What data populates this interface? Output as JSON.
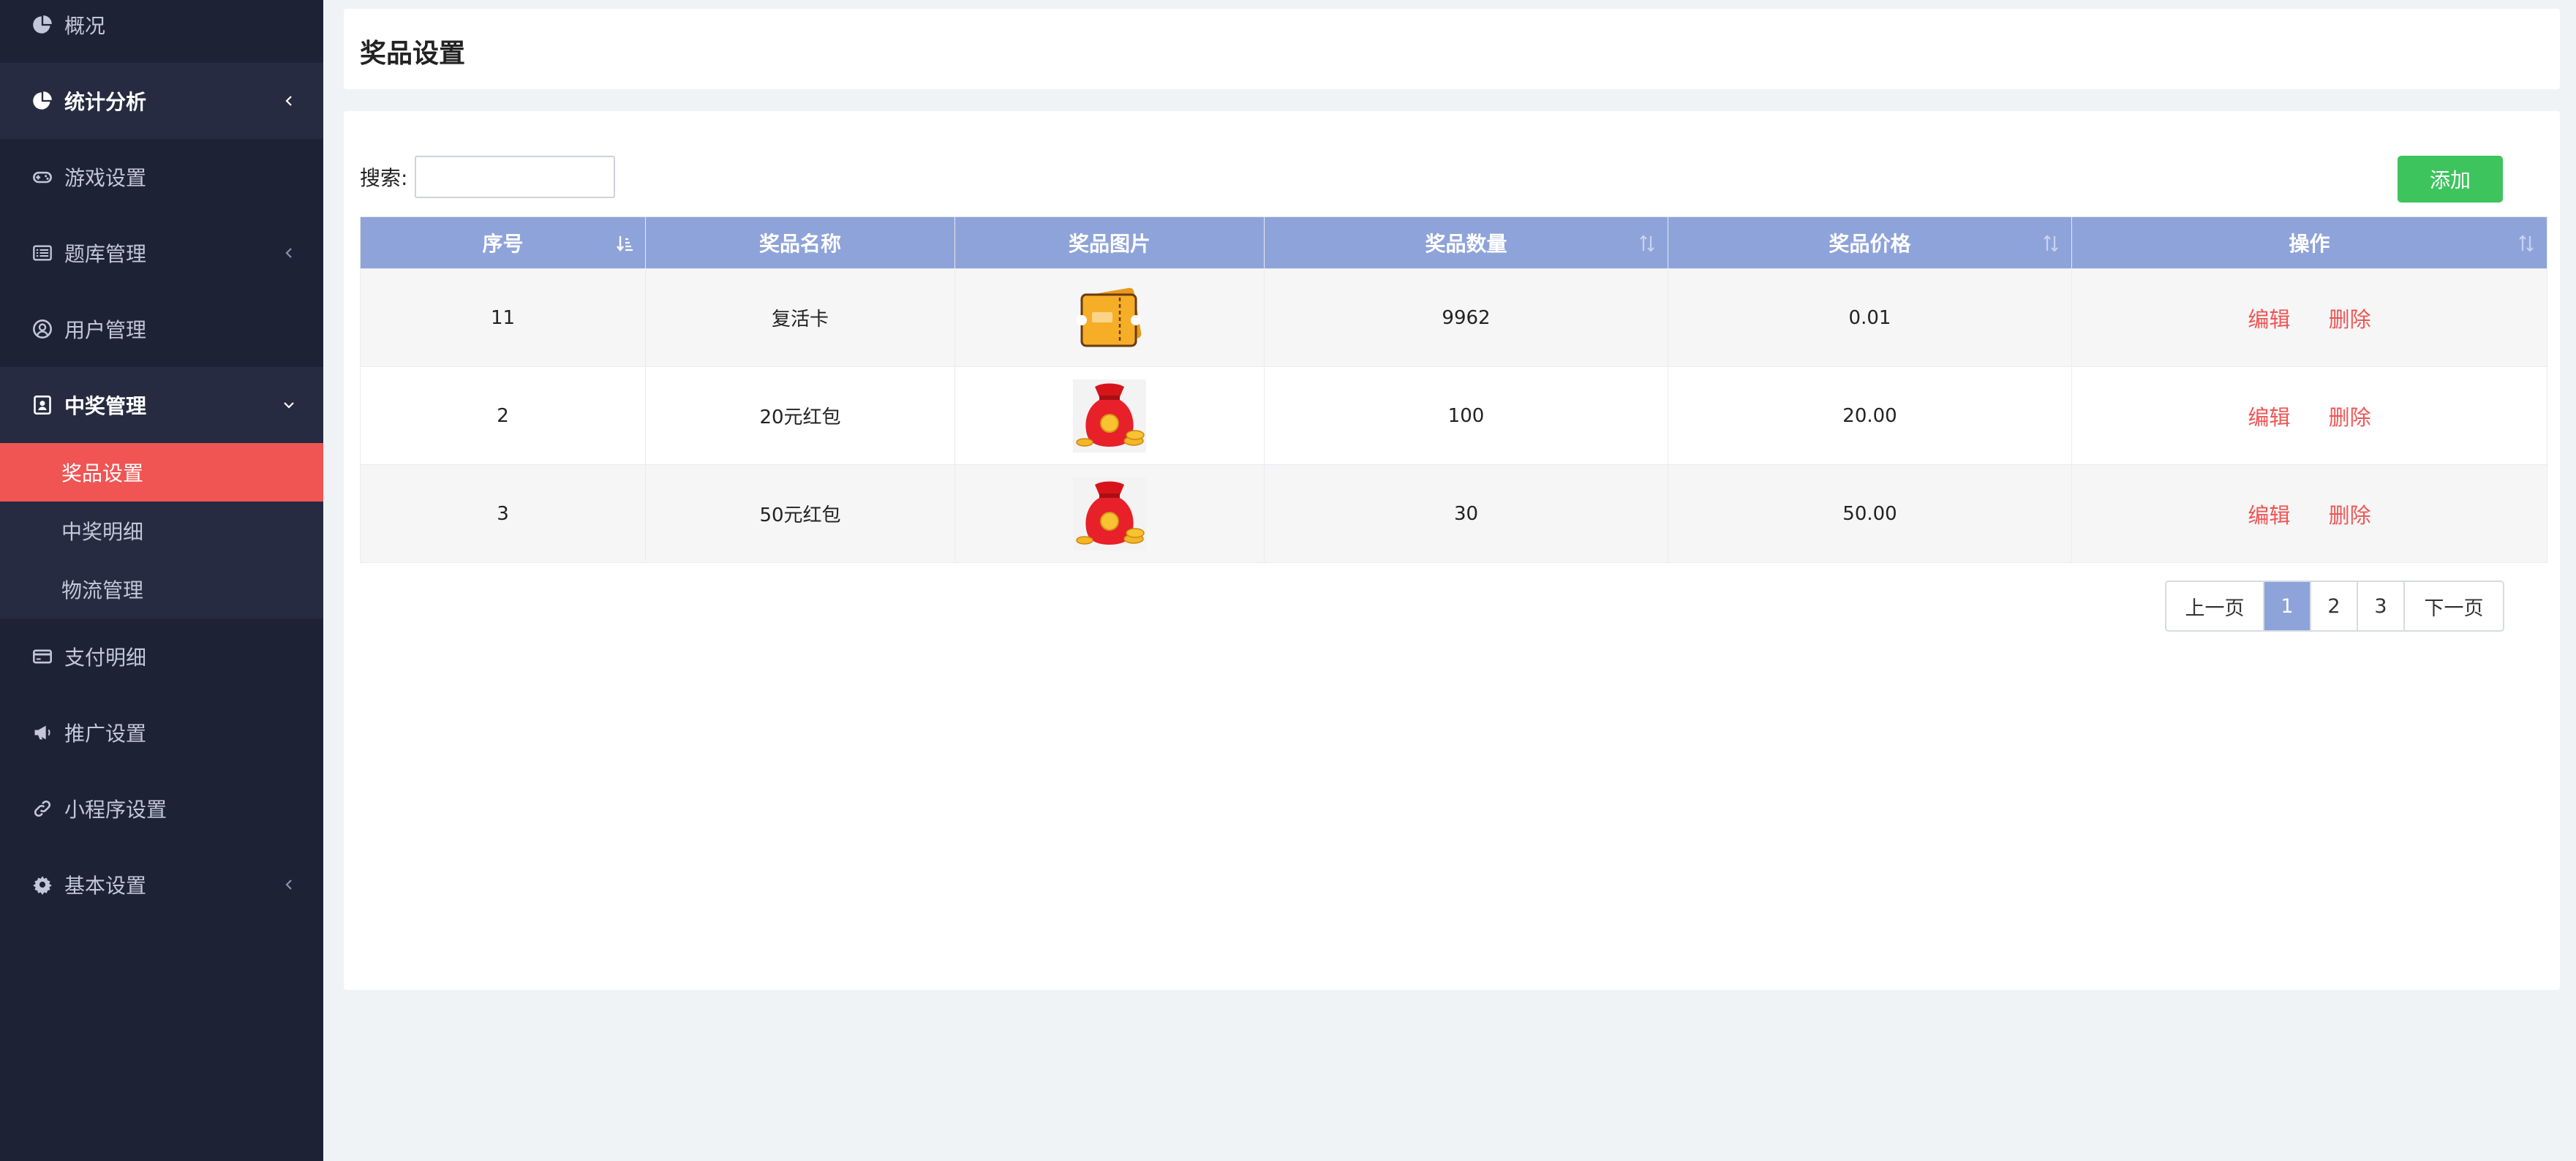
{
  "sidebar": {
    "items": [
      {
        "label": "概况",
        "icon": "pie-chart-icon"
      },
      {
        "label": "统计分析",
        "icon": "pie-chart-icon",
        "active": true,
        "has_arrow": true
      },
      {
        "label": "游戏设置",
        "icon": "gamepad-icon"
      },
      {
        "label": "题库管理",
        "icon": "list-icon",
        "has_arrow": true
      },
      {
        "label": "用户管理",
        "icon": "user-circle-icon"
      },
      {
        "label": "中奖管理",
        "icon": "contact-card-icon",
        "active": true,
        "expanded": true
      },
      {
        "label": "支付明细",
        "icon": "credit-card-icon"
      },
      {
        "label": "推广设置",
        "icon": "megaphone-icon"
      },
      {
        "label": "小程序设置",
        "icon": "link-icon"
      },
      {
        "label": "基本设置",
        "icon": "gear-icon",
        "has_arrow": true
      }
    ],
    "submenu": [
      {
        "label": "奖品设置",
        "active": true
      },
      {
        "label": "中奖明细"
      },
      {
        "label": "物流管理"
      }
    ]
  },
  "header": {
    "title": "奖品设置"
  },
  "toolbar": {
    "search_label": "搜索:",
    "search_value": "",
    "add_label": "添加"
  },
  "table": {
    "columns": [
      "序号",
      "奖品名称",
      "奖品图片",
      "奖品数量",
      "奖品价格",
      "操作"
    ],
    "rows": [
      {
        "id": "11",
        "name": "复活卡",
        "image": "ticket-icon",
        "quantity": "9962",
        "price": "0.01",
        "edit": "编辑",
        "delete": "删除"
      },
      {
        "id": "2",
        "name": "20元红包",
        "image": "red-envelope-icon",
        "quantity": "100",
        "price": "20.00",
        "edit": "编辑",
        "delete": "删除"
      },
      {
        "id": "3",
        "name": "50元红包",
        "image": "red-envelope-icon",
        "quantity": "30",
        "price": "50.00",
        "edit": "编辑",
        "delete": "删除"
      }
    ]
  },
  "pagination": {
    "prev": "上一页",
    "pages": [
      "1",
      "2",
      "3"
    ],
    "current": "1",
    "next": "下一页"
  },
  "colors": {
    "sidebar_bg": "#1e2235",
    "accent_red": "#f05554",
    "header_blue": "#8ea3d9",
    "add_green": "#3ec45d"
  }
}
